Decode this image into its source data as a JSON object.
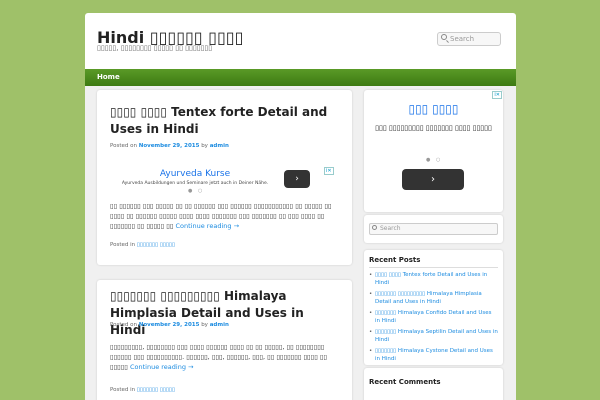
{
  "site": {
    "title": "Hindi ▯▯▯▯▯▯ ▯▯▯▯",
    "tagline": "▯▯▯▯▯, ▯▯▯▯▯▯▯▯ ▯▯▯▯▯ ▯▯ ▯▯▯▯▯▯▯"
  },
  "search": {
    "placeholder": "Search"
  },
  "nav": {
    "home_label": "Home"
  },
  "posts": [
    {
      "title": "▯▯▯▯ ▯▯▯▯ Tentex forte Detail and Uses in Hindi",
      "posted_on_label": "Posted on",
      "date": "November 29, 2015",
      "by_label": "by",
      "author": "admin",
      "excerpt": "▯▯ ▯▯▯▯▯▯ ▯▯▯ ▯▯▯▯▯ ▯▯ ▯▯ ▯▯▯▯▯▯ ▯▯▯ ▯▯▯▯▯▯ ▯▯▯▯▯▯▯▯▯▯▯ ▯▯ ▯▯▯▯▯ ▯▯ ▯▯▯▯ ▯▯ ▯▯▯▯▯▯ ▯▯▯▯▯ ▯▯▯▯ ▯▯▯▯ ▯▯▯▯▯▯▯ ▯▯▯ ▯▯▯▯▯▯▯ ▯▯ ▯▯▯ ▯▯▯▯ ▯▯ ▯▯▯▯▯▯▯ ▯▯ ▯▯▯▯▯ ▯▯",
      "continue_label": "Continue reading →",
      "posted_in_label": "Posted in",
      "category": "▯▯▯▯▯▯▯ ▯▯▯▯▯"
    },
    {
      "title": "▯▯▯▯▯▯▯ ▯▯▯▯▯▯▯▯▯ Himalaya Himplasia Detail and Uses in Hindi",
      "posted_on_label": "Posted on",
      "date": "November 29, 2015",
      "by_label": "by",
      "author": "admin",
      "excerpt": "▯▯▯▯▯▯▯▯▯, ▯▯▯▯▯▯▯▯ ▯▯▯ ▯▯▯▯ ▯▯▯▯▯▯ ▯▯▯▯ ▯▯ ▯▯ ▯▯▯▯▯, ▯▯ ▯▯▯▯▯▯▯▯ ▯▯▯▯▯▯ ▯▯▯ ▯▯▯▯▯▯▯▯▯▯. ▯▯▯▯▯▯, ▯▯▯, ▯▯▯▯▯▯, ▯▯▯, ▯▯ ▯▯▯▯▯▯▯ ▯▯▯▯ ▯▯ ▯▯▯▯▯",
      "continue_label": "Continue reading →",
      "posted_in_label": "Posted in",
      "category": "▯▯▯▯▯▯▯ ▯▯▯▯▯"
    }
  ],
  "ad_inline": {
    "title": "Ayurveda Kurse",
    "text": "Ayurveda Ausbildungen und Seminare jetzt auch in Deiner Nähe.",
    "arrow": "›"
  },
  "ad_sidebar": {
    "title": "▯▯▯ ▯▯▯▯",
    "text": "▯▯▯ ▯▯▯▯▯▯▯▯▯ ▯▯▯▯▯▯▯ ▯▯▯▯ ▯▯▯▯▯",
    "arrow": "›"
  },
  "sidebar_search": {
    "placeholder": "Search"
  },
  "recent_posts": {
    "heading": "Recent Posts",
    "items": [
      "▯▯▯▯ ▯▯▯▯ Tentex forte Detail and Uses in Hindi",
      "▯▯▯▯▯▯▯ ▯▯▯▯▯▯▯▯▯ Himalaya Himplasia Detail and Uses in Hindi",
      "▯▯▯▯▯▯▯ Himalaya Confido Detail and Uses in Hindi",
      "▯▯▯▯▯▯▯ Himalaya Septilin Detail and Uses in Hindi",
      "▯▯▯▯▯▯▯ Himalaya Cystone Detail and Uses in Hindi"
    ]
  },
  "recent_comments": {
    "heading": "Recent Comments"
  },
  "colors": {
    "background": "#9fc169",
    "nav": "#4a8a1c",
    "link": "#1b8be0"
  }
}
